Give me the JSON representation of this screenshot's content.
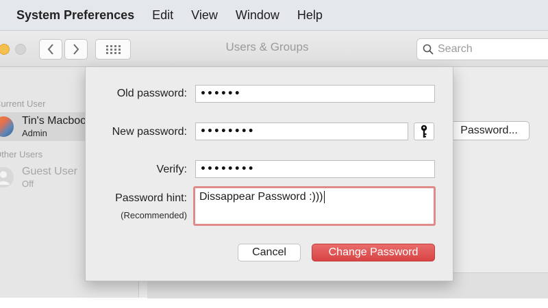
{
  "menubar": {
    "app_name": "System Preferences",
    "items": [
      "Edit",
      "View",
      "Window",
      "Help"
    ]
  },
  "window": {
    "title": "Users & Groups",
    "search_placeholder": "Search"
  },
  "sidebar": {
    "current_user_label": "Current User",
    "current_user": {
      "name": "Tin's Macbook",
      "role": "Admin"
    },
    "other_users_label": "Other Users",
    "other_user": {
      "name": "Guest User",
      "role": "Off"
    }
  },
  "content": {
    "change_password_button": "Password..."
  },
  "dialog": {
    "old_password_label": "Old password:",
    "old_password_value": "••••••",
    "new_password_label": "New password:",
    "new_password_value": "••••••••",
    "verify_label": "Verify:",
    "verify_value": "••••••••",
    "hint_label": "Password hint:",
    "hint_sublabel": "(Recommended)",
    "hint_value": "Dissappear Password :)))",
    "cancel_label": "Cancel",
    "change_label": "Change Password"
  },
  "colors": {
    "accent_red": "#d94545",
    "hint_border": "#e08a8a"
  },
  "icons": [
    "search-icon",
    "key-icon",
    "chevron-left-icon",
    "chevron-right-icon",
    "grid-icon"
  ]
}
